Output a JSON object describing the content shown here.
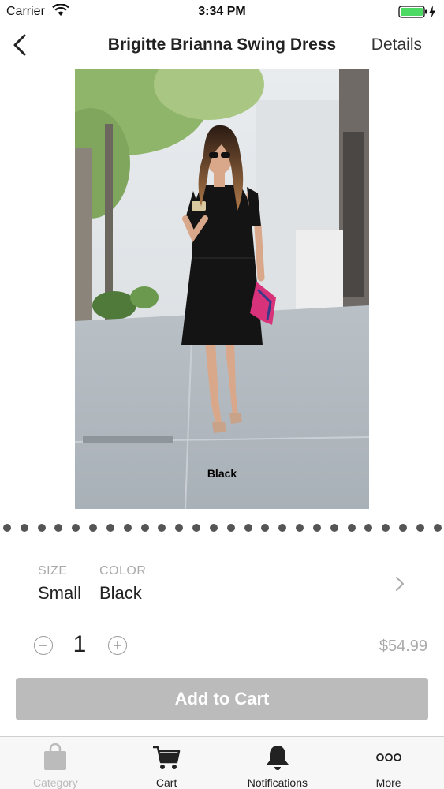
{
  "status_bar": {
    "carrier": "Carrier",
    "time": "3:34 PM",
    "battery_color": "#4cd964"
  },
  "nav": {
    "back_icon": "chevron-left-icon",
    "title": "Brigitte Brianna Swing Dress",
    "details_label": "Details"
  },
  "product_image": {
    "caption": "Black"
  },
  "carousel": {
    "page_count": 26
  },
  "variant": {
    "size_label": "SIZE",
    "size_value": "Small",
    "color_label": "COLOR",
    "color_value": "Black"
  },
  "quantity": {
    "value": "1",
    "price": "$54.99"
  },
  "add_to_cart": {
    "label": "Add to Cart",
    "color": "#bbbbbb"
  },
  "tabs": [
    {
      "label": "Category",
      "icon": "shopping-bag-icon",
      "enabled": false
    },
    {
      "label": "Cart",
      "icon": "cart-icon",
      "enabled": true
    },
    {
      "label": "Notifications",
      "icon": "bell-icon",
      "enabled": true
    },
    {
      "label": "More",
      "icon": "more-icon",
      "enabled": true
    }
  ]
}
